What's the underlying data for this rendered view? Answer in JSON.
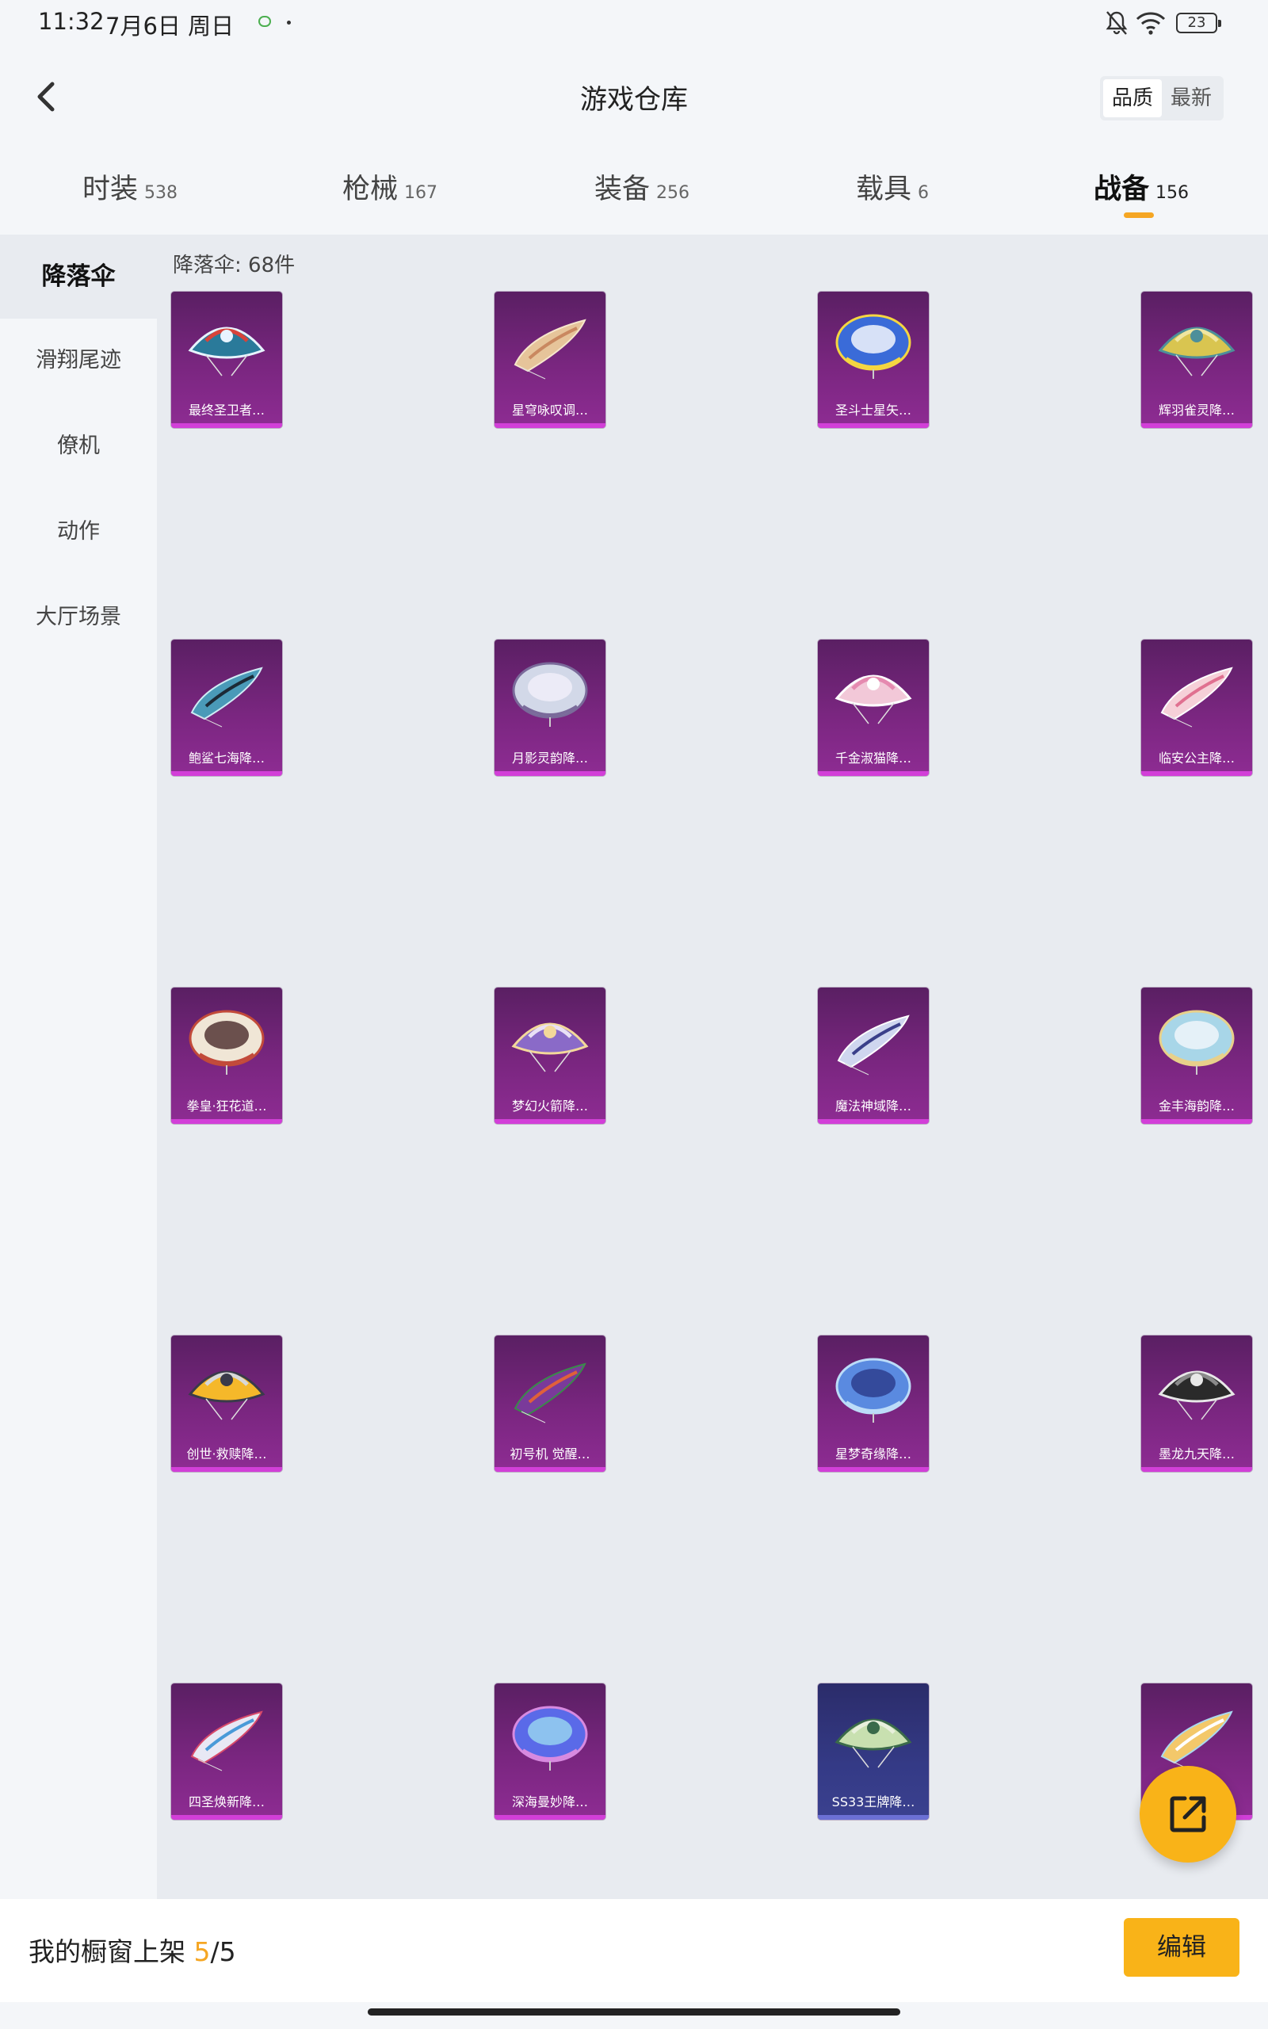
{
  "status_bar": {
    "time": "11:32",
    "date": "7月6日 周日",
    "battery": "23"
  },
  "header": {
    "title": "游戏仓库",
    "sort_options": [
      "品质",
      "最新"
    ],
    "sort_active": "品质"
  },
  "tabs": [
    {
      "name": "时装",
      "count": "538"
    },
    {
      "name": "枪械",
      "count": "167"
    },
    {
      "name": "装备",
      "count": "256"
    },
    {
      "name": "载具",
      "count": "6"
    },
    {
      "name": "战备",
      "count": "156"
    }
  ],
  "sidebar": {
    "items": [
      "降落伞",
      "滑翔尾迹",
      "僚机",
      "动作",
      "大厅场景"
    ]
  },
  "main": {
    "count_label": "降落伞: 68件"
  },
  "items": [
    {
      "name": "最终圣卫者…",
      "colors": [
        "#2a7a9a",
        "#e8f4ff",
        "#d8433a"
      ]
    },
    {
      "name": "星穹咏叹调…",
      "colors": [
        "#e6c49a",
        "#c98860",
        "#f6e6cc"
      ]
    },
    {
      "name": "圣斗士星矢…",
      "colors": [
        "#3a6bd8",
        "#f5d640",
        "#ffffff"
      ]
    },
    {
      "name": "辉羽雀灵降…",
      "colors": [
        "#d9c550",
        "#4d8f9a",
        "#f0e6a0"
      ]
    },
    {
      "name": "鲍鲨七海降…",
      "colors": [
        "#4a9ab8",
        "#1c2a36",
        "#d0ecf5"
      ]
    },
    {
      "name": "月影灵韵降…",
      "colors": [
        "#d2d8e8",
        "#7a6a9a",
        "#f3f0fa"
      ]
    },
    {
      "name": "千金淑猫降…",
      "colors": [
        "#f2c8d8",
        "#ffffff",
        "#e58ab0"
      ]
    },
    {
      "name": "临安公主降…",
      "colors": [
        "#f6d0d8",
        "#e07090",
        "#ffffff"
      ]
    },
    {
      "name": "拳皇·狂花道…",
      "colors": [
        "#f0e6d6",
        "#c24a3a",
        "#4a2a2a"
      ]
    },
    {
      "name": "梦幻火箭降…",
      "colors": [
        "#8a6ac8",
        "#f3d89a",
        "#e9e0f6"
      ]
    },
    {
      "name": "魔法神域降…",
      "colors": [
        "#cfd6ef",
        "#3a3f8a",
        "#ffffff"
      ]
    },
    {
      "name": "金丰海韵降…",
      "colors": [
        "#a8d6e8",
        "#e8d08a",
        "#f4f8fb"
      ]
    },
    {
      "name": "创世·救赎降…",
      "colors": [
        "#f5b82a",
        "#3a3a4a",
        "#d8d8d8"
      ]
    },
    {
      "name": "初号机 觉醒…",
      "colors": [
        "#7a3a9a",
        "#e0603a",
        "#3a8a4a"
      ]
    },
    {
      "name": "星梦奇缘降…",
      "colors": [
        "#5a8ae0",
        "#bcdcf8",
        "#2a3a8a"
      ]
    },
    {
      "name": "墨龙九天降…",
      "colors": [
        "#2a2a2a",
        "#e8e8e8",
        "#8a8a8a"
      ]
    },
    {
      "name": "四圣焕新降…",
      "colors": [
        "#e8e8f4",
        "#4a9ad8",
        "#d84a6a"
      ]
    },
    {
      "name": "深海曼妙降…",
      "colors": [
        "#5a6ae8",
        "#d88ae0",
        "#9ad8f0"
      ]
    },
    {
      "name": "SS33王牌降…",
      "colors": [
        "#c8e0b0",
        "#3a6a4a",
        "#e8f0dc"
      ]
    },
    {
      "name": "",
      "colors": [
        "#f3c86a",
        "#ffffff",
        "#a8d8f0"
      ]
    }
  ],
  "bottom_bar": {
    "label": "我的橱窗上架",
    "current": "5",
    "total": "/5",
    "edit_label": "编辑"
  }
}
